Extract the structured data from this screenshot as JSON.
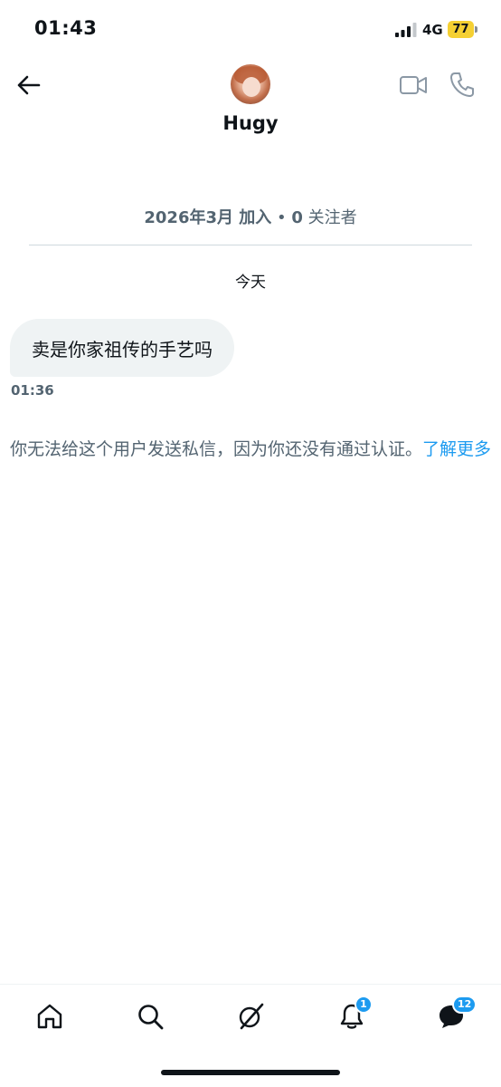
{
  "status_bar": {
    "time": "01:43",
    "network": "4G",
    "battery": "77"
  },
  "header": {
    "contact_name": "Hugy",
    "icons": [
      "back-arrow-icon",
      "avatar",
      "video-call-icon",
      "phone-icon"
    ]
  },
  "profile_info": {
    "joined": "2026年3月 加入",
    "separator": "•",
    "follower_count": "0",
    "follower_label": "关注者"
  },
  "conversation": {
    "day_label": "今天",
    "messages": [
      {
        "text": "卖是你家祖传的手艺吗",
        "time": "01:36",
        "direction": "incoming"
      }
    ]
  },
  "notice": {
    "text": "你无法给这个用户发送私信，因为你还没有通过认证。",
    "link": "了解更多"
  },
  "tab_bar": {
    "tabs": [
      {
        "name": "home",
        "icon": "home-icon"
      },
      {
        "name": "search",
        "icon": "search-icon"
      },
      {
        "name": "grok",
        "icon": "grok-icon"
      },
      {
        "name": "notifications",
        "icon": "bell-icon",
        "badge": "1"
      },
      {
        "name": "messages",
        "icon": "messages-icon",
        "badge": "12"
      }
    ]
  },
  "colors": {
    "accent": "#1d9bf0",
    "secondary_text": "#536471",
    "bubble_bg": "#eff3f4",
    "battery": "#f5d033"
  }
}
